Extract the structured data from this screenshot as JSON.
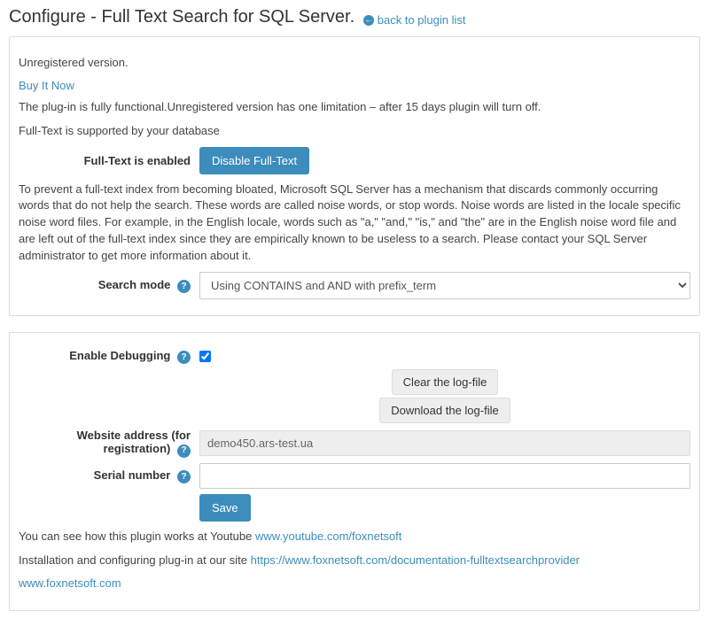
{
  "header": {
    "title": "Configure - Full Text Search for SQL Server.",
    "back_label": "back to plugin list"
  },
  "panel1": {
    "unregistered": "Unregistered version.",
    "buy_now": "Buy It Now",
    "limitation": "The plug-in is fully functional.Unregistered version has one limitation – after 15 days plugin will turn off.",
    "supported": "Full-Text is supported by your database",
    "enabled_label": "Full-Text is enabled",
    "disable_btn": "Disable Full-Text",
    "noise_words": "To prevent a full-text index from becoming bloated, Microsoft SQL Server has a mechanism that discards commonly occurring words that do not help the search. These words are called noise words, or stop words. Noise words are listed in the locale specific noise word files. For example, in the English locale, words such as \"a,\" \"and,\" \"is,\" and \"the\" are in the English noise word file and are left out of the full-text index since they are empirically known to be useless to a search. Please contact your SQL Server administrator to get more information about it.",
    "search_mode_label": "Search mode",
    "search_mode_value": "Using CONTAINS and AND with prefix_term"
  },
  "panel2": {
    "debug_label": "Enable Debugging",
    "debug_checked": true,
    "clear_log_btn": "Clear the log-file",
    "download_log_btn": "Download the log-file",
    "website_label": "Website address (for registration)",
    "website_value": "demo450.ars-test.ua",
    "serial_label": "Serial number",
    "serial_value": "",
    "save_btn": "Save",
    "youtube_text": "You can see how this plugin works at Youtube ",
    "youtube_link": "www.youtube.com/foxnetsoft",
    "install_text": "Installation and configuring plug-in at our site ",
    "install_link": "https://www.foxnetsoft.com/documentation-fulltextsearchprovider",
    "site_link": "www.foxnetsoft.com"
  }
}
